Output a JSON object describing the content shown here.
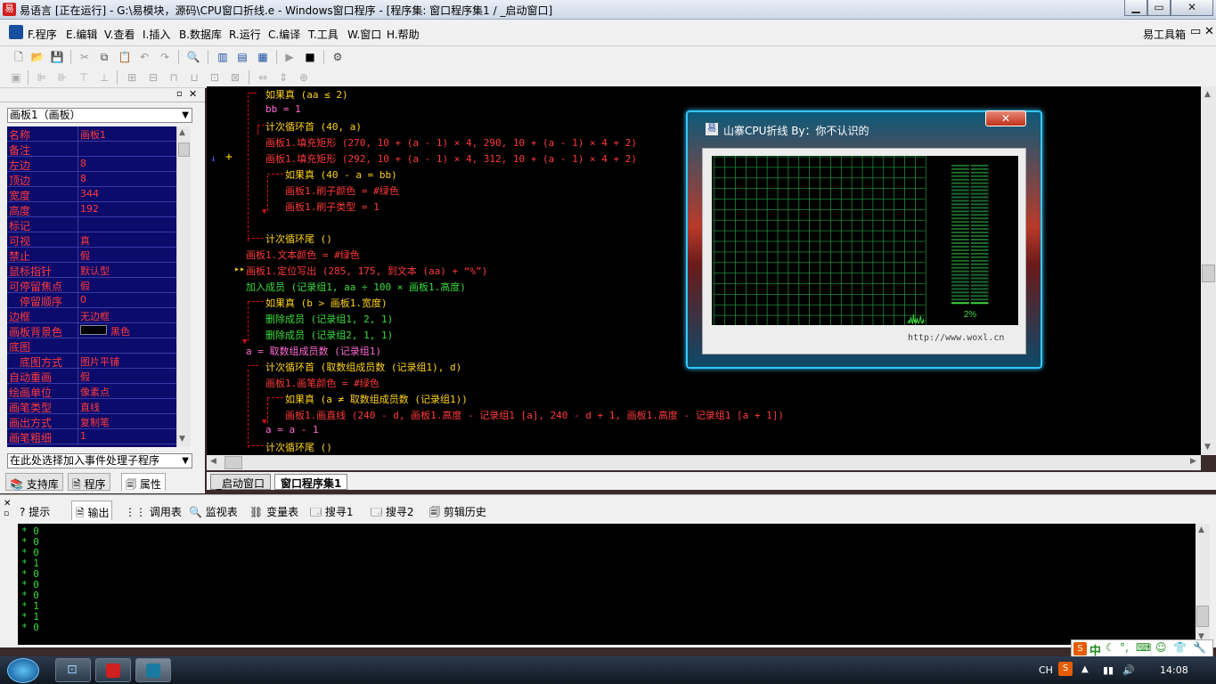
{
  "window": {
    "title": "易语言 [正在运行] - G:\\易模块，源码\\CPU窗口折线.e - Windows窗口程序 - [程序集: 窗口程序集1 / _启动窗口]",
    "minimize": "▁",
    "maximize": "▭",
    "close": "✕"
  },
  "menu": {
    "items": [
      "F.程序",
      "E.编辑",
      "V.查看",
      "I.插入",
      "B.数据库",
      "R.运行",
      "C.编译",
      "T.工具",
      "W.窗口",
      "H.帮助"
    ],
    "toolbox": "易工具箱"
  },
  "left_panel": {
    "combo": "画板1（画板）",
    "props": [
      {
        "name": "名称",
        "value": "画板1"
      },
      {
        "name": "备注",
        "value": ""
      },
      {
        "name": "左边",
        "value": "8"
      },
      {
        "name": "顶边",
        "value": "8"
      },
      {
        "name": "宽度",
        "value": "344"
      },
      {
        "name": "高度",
        "value": "192"
      },
      {
        "name": "标记",
        "value": ""
      },
      {
        "name": "可视",
        "value": "真"
      },
      {
        "name": "禁止",
        "value": "假"
      },
      {
        "name": "鼠标指针",
        "value": "默认型"
      },
      {
        "name": "可停留焦点",
        "value": "假"
      },
      {
        "name": "停留顺序",
        "value": "0"
      },
      {
        "name": "边框",
        "value": "无边框"
      },
      {
        "name": "画板背景色",
        "value": "黑色"
      },
      {
        "name": "底图",
        "value": ""
      },
      {
        "name": "底图方式",
        "value": "图片平铺"
      },
      {
        "name": "自动重画",
        "value": "假"
      },
      {
        "name": "绘画单位",
        "value": "像素点"
      },
      {
        "name": "画笔类型",
        "value": "直线"
      },
      {
        "name": "画出方式",
        "value": "复制笔"
      },
      {
        "name": "画笔粗细",
        "value": "1"
      }
    ],
    "event_combo": "在此处选择加入事件处理子程序",
    "tabs": [
      "支持库",
      "程序",
      "属性"
    ]
  },
  "editor": {
    "lines": [
      {
        "text": "如果真 (aa ≤ 2)",
        "color": "#ffd21a"
      },
      {
        "text": "bb = 1",
        "color": "#ff6ad5"
      },
      {
        "text": "计次循环首 (40, a)",
        "color": "#ffd21a"
      },
      {
        "text": "画板1.填充矩形 (270, 10 + (a - 1) × 4, 290, 10 + (a - 1) × 4 + 2)",
        "color": "#ff3a3a"
      },
      {
        "text": "画板1.填充矩形 (292, 10 + (a - 1) × 4, 312, 10 + (a - 1) × 4 + 2)",
        "color": "#ff3a3a"
      },
      {
        "text": "如果真 (40 - a = bb)",
        "color": "#ffd21a"
      },
      {
        "text": "画板1.刷子颜色 = #绿色",
        "color": "#ff3a3a"
      },
      {
        "text": "画板1.刷子类型 = 1",
        "color": "#ff3a3a"
      },
      {
        "text": "",
        "color": "#ff3a3a"
      },
      {
        "text": "计次循环尾 ()",
        "color": "#ffd21a"
      },
      {
        "text": "画板1.文本颜色 = #绿色",
        "color": "#ff3a3a"
      },
      {
        "text": "画板1.定位写出 (285, 175, 到文本 (aa) + “%”)",
        "color": "#ff3a3a"
      },
      {
        "text": "加入成员 (记录组1, aa ÷ 100 × 画板1.高度)",
        "color": "#3cdc3c"
      },
      {
        "text": "如果真 (b > 画板1.宽度)",
        "color": "#ffd21a"
      },
      {
        "text": "删除成员 (记录组1, 2, 1)",
        "color": "#3cdc3c"
      },
      {
        "text": "删除成员 (记录组2, 1, 1)",
        "color": "#3cdc3c"
      },
      {
        "text": "a = 取数组成员数 (记录组1)",
        "color": "#ff6ad5"
      },
      {
        "text": "计次循环首 (取数组成员数 (记录组1), d)",
        "color": "#ffd21a"
      },
      {
        "text": "画板1.画笔颜色 = #绿色",
        "color": "#ff3a3a"
      },
      {
        "text": "如果真 (a ≠ 取数组成员数 (记录组1))",
        "color": "#ffd21a"
      },
      {
        "text": "画板1.画直线 (240 - d, 画板1.高度 - 记录组1 [a], 240 - d + 1, 画板1.高度 - 记录组1 [a + 1])",
        "color": "#ff3a3a"
      },
      {
        "text": "a = a - 1",
        "color": "#ff6ad5"
      },
      {
        "text": "计次循环尾 ()",
        "color": "#ffd21a"
      }
    ],
    "tabs": [
      "_启动窗口",
      "窗口程序集1"
    ]
  },
  "float_window": {
    "title": "山寨CPU折线  By：你不认识的",
    "close": "✕",
    "percent": "2%",
    "url": "http://www.woxl.cn",
    "cpu_level": 0.02
  },
  "bottom_panel": {
    "tabs": [
      "提示",
      "输出",
      "调用表",
      "监视表",
      "变量表",
      "搜寻1",
      "搜寻2",
      "剪辑历史"
    ],
    "output": [
      "* 0",
      "* 0",
      "* 0",
      "* 1",
      "* 0",
      "* 0",
      "* 0",
      "* 1",
      "* 1",
      "* 0"
    ]
  },
  "taskbar": {
    "lang": "CH",
    "time": "14:08"
  },
  "ime": {
    "label": "中"
  }
}
